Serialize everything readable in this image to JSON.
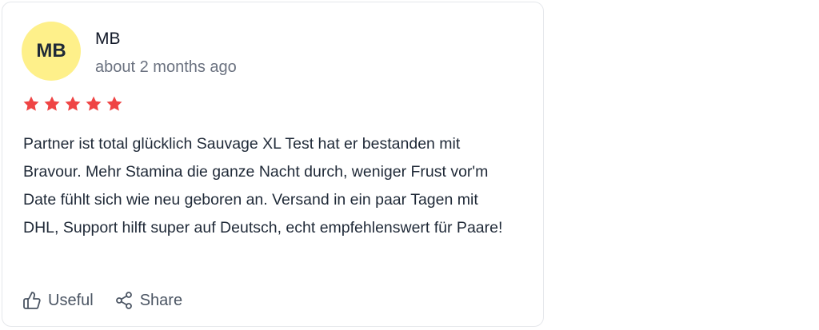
{
  "review": {
    "avatar_initials": "MB",
    "reviewer_name": "MB",
    "time_ago": "about 2 months ago",
    "rating": 5,
    "rating_max": 5,
    "star_color": "#ef4444",
    "avatar_color": "#fef08a",
    "text": "Partner ist total glücklich Sauvage XL Test hat er bestanden mit Bravour. Mehr Stamina die ganze Nacht durch, weniger Frust vor'm Date fühlt sich wie neu geboren an. Versand in ein paar Tagen mit DHL, Support hilft super auf Deutsch, echt empfehlenswert für Paare!"
  },
  "actions": {
    "useful_label": "Useful",
    "useful_icon": "thumbs-up-icon",
    "share_label": "Share",
    "share_icon": "share-icon"
  }
}
